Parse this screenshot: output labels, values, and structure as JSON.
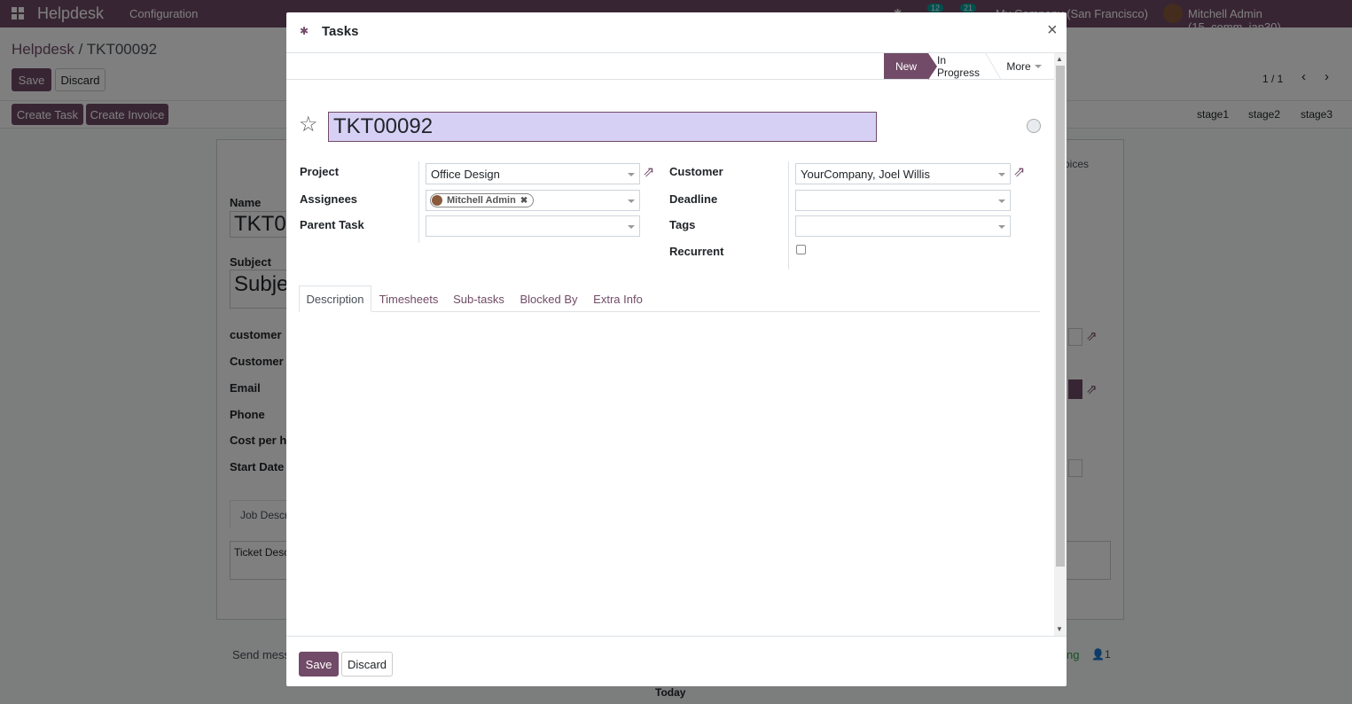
{
  "app": {
    "title": "Helpdesk",
    "menu_configuration": "Configuration",
    "badge_chat": "12",
    "badge_activity": "21",
    "company": "My Company (San Francisco)",
    "user": "Mitchell Admin (15_comm_jan30)"
  },
  "breadcrumb": {
    "parent": "Helpdesk",
    "separator": " / ",
    "current": "TKT00092"
  },
  "controls": {
    "save": "Save",
    "discard": "Discard",
    "pager": "1 / 1"
  },
  "actions": {
    "create_task": "Create Task",
    "create_invoice": "Create Invoice"
  },
  "stages_bg": [
    "stage1",
    "stage2",
    "stage3"
  ],
  "ticket_form": {
    "name_label": "Name",
    "name_value": "TKT00",
    "subject_label": "Subject",
    "subject_value": "Subje",
    "customer_label": "customer",
    "customer_name_label": "Customer N",
    "email_label": "Email",
    "phone_label": "Phone",
    "cost_label": "Cost per ho",
    "start_date_label": "Start Date",
    "tab_job": "Job Descr",
    "ticket_desc": "Ticket Desc",
    "tab_invoices": "oices"
  },
  "chatter": {
    "send_message": "Send messa",
    "log": "ng",
    "followers": "1",
    "today": "Today"
  },
  "modal": {
    "title": "Tasks",
    "close": "×",
    "stages": [
      "New",
      "In Progress"
    ],
    "more": "More",
    "task_name": "TKT00092",
    "labels": {
      "project": "Project",
      "assignees": "Assignees",
      "parent_task": "Parent Task",
      "customer": "Customer",
      "deadline": "Deadline",
      "tags": "Tags",
      "recurrent": "Recurrent"
    },
    "values": {
      "project": "Office Design",
      "assignee": "Mitchell Admin",
      "parent_task": "",
      "customer": "YourCompany, Joel Willis",
      "deadline": "",
      "tags": ""
    },
    "recurrent_checked": false,
    "tabs": [
      "Description",
      "Timesheets",
      "Sub-tasks",
      "Blocked By",
      "Extra Info"
    ],
    "save": "Save",
    "discard": "Discard"
  },
  "colors": {
    "brand": "#714b67",
    "input_highlight": "#d6d0f5"
  }
}
